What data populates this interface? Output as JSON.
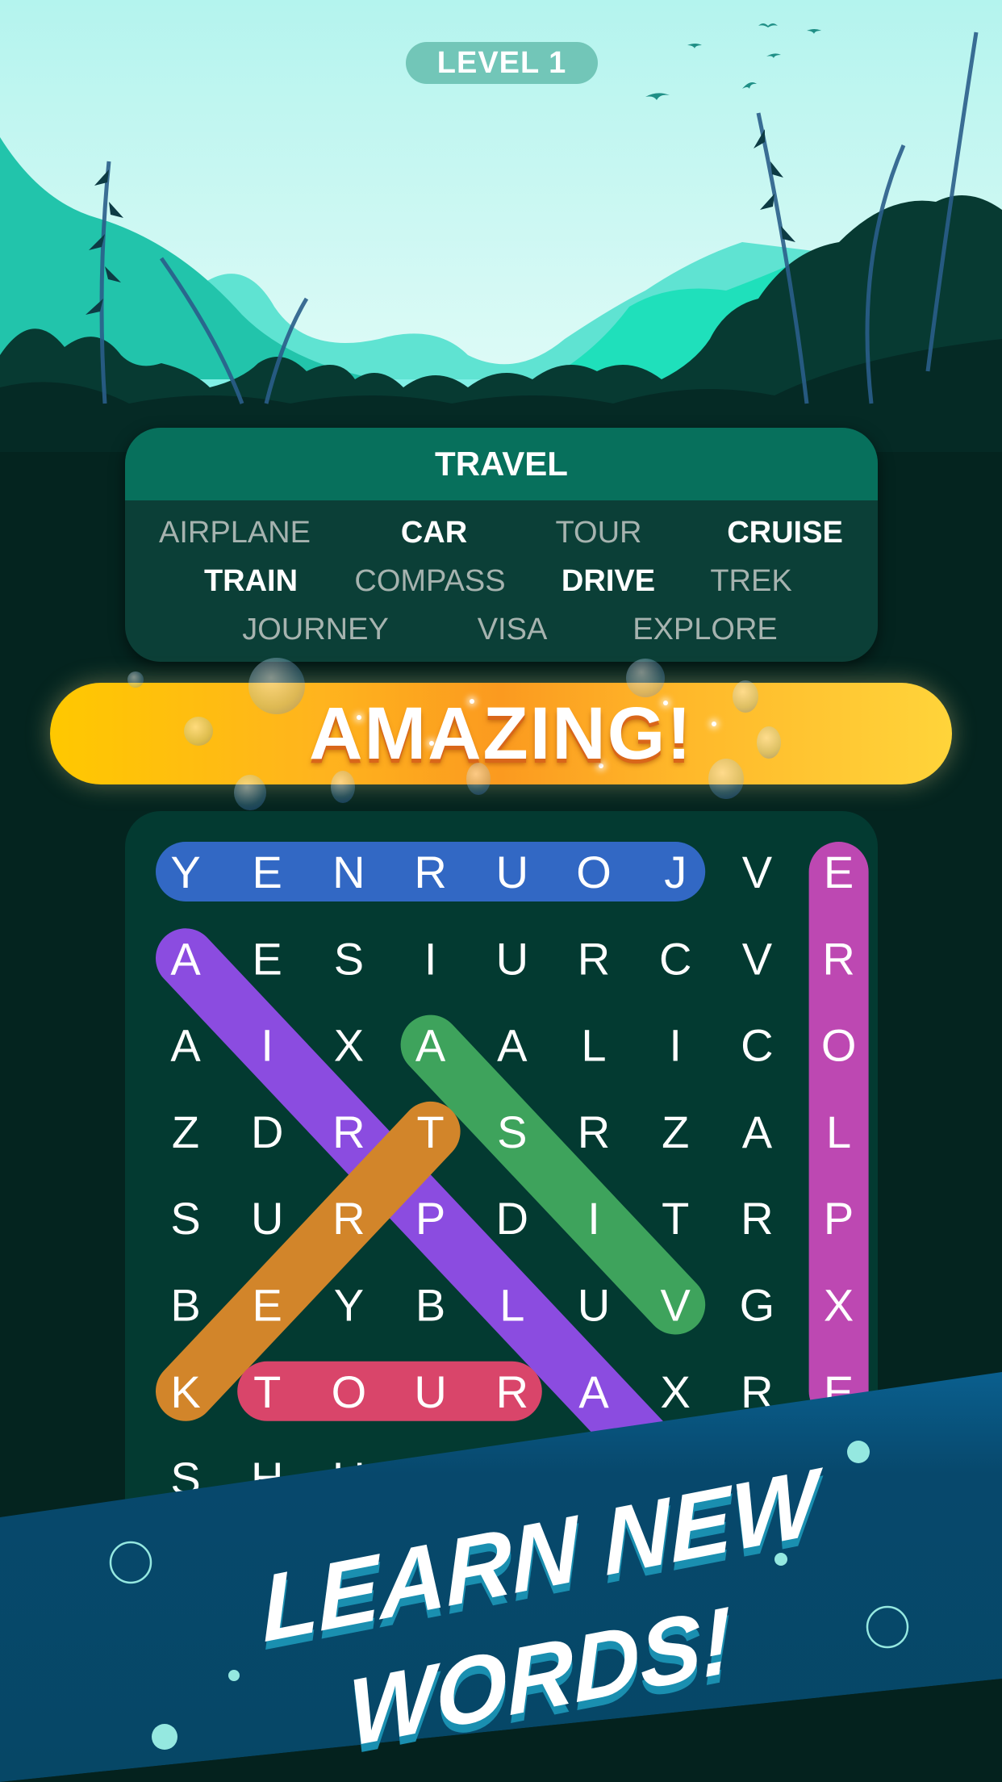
{
  "header": {
    "level_label": "LEVEL 1"
  },
  "word_list": {
    "category": "TRAVEL",
    "rows": [
      [
        {
          "text": "AIRPLANE",
          "found": true
        },
        {
          "text": "CAR",
          "found": false
        },
        {
          "text": "TOUR",
          "found": true
        },
        {
          "text": "CRUISE",
          "found": false
        }
      ],
      [
        {
          "text": "TRAIN",
          "found": false
        },
        {
          "text": "COMPASS",
          "found": true
        },
        {
          "text": "DRIVE",
          "found": false
        },
        {
          "text": "TREK",
          "found": true
        }
      ],
      [
        {
          "text": "JOURNEY",
          "found": true
        },
        {
          "text": "VISA",
          "found": true
        },
        {
          "text": "EXPLORE",
          "found": true
        }
      ]
    ]
  },
  "celebration": {
    "text": "AMAZING!"
  },
  "grid": {
    "columns": 9,
    "rows": [
      [
        "Y",
        "E",
        "N",
        "R",
        "U",
        "O",
        "J",
        "V",
        "E"
      ],
      [
        "A",
        "E",
        "S",
        "I",
        "U",
        "R",
        "C",
        "V",
        "R"
      ],
      [
        "A",
        "I",
        "X",
        "A",
        "A",
        "L",
        "I",
        "C",
        "O"
      ],
      [
        "Z",
        "D",
        "R",
        "T",
        "S",
        "R",
        "Z",
        "A",
        "L"
      ],
      [
        "S",
        "U",
        "R",
        "P",
        "D",
        "I",
        "T",
        "R",
        "P"
      ],
      [
        "B",
        "E",
        "Y",
        "B",
        "L",
        "U",
        "V",
        "G",
        "X"
      ],
      [
        "K",
        "T",
        "O",
        "U",
        "R",
        "A",
        "X",
        "R",
        "E"
      ],
      [
        "S",
        "H",
        "U",
        "",
        "",
        "",
        "",
        "",
        ""
      ]
    ],
    "highlights": [
      {
        "word": "JOURNEY",
        "color": "#3268c4",
        "from": [
          0,
          6
        ],
        "to": [
          0,
          0
        ]
      },
      {
        "word": "EXPLORE",
        "color": "#bd48b2",
        "from": [
          6,
          8
        ],
        "to": [
          0,
          8
        ]
      },
      {
        "word": "AIRPLANE",
        "color": "#8b4ce0",
        "from": [
          1,
          0
        ],
        "to": [
          7,
          6
        ]
      },
      {
        "word": "VISA",
        "color": "#3ea35c",
        "from": [
          5,
          6
        ],
        "to": [
          2,
          3
        ]
      },
      {
        "word": "TREK",
        "color": "#d2852a",
        "from": [
          3,
          3
        ],
        "to": [
          6,
          0
        ]
      },
      {
        "word": "TOUR",
        "color": "#d9456a",
        "from": [
          6,
          1
        ],
        "to": [
          6,
          4
        ]
      }
    ]
  },
  "promo": {
    "line1": "LEARN NEW",
    "line2": "WORDS!"
  },
  "colors": {
    "banner": "#07476a",
    "accent_dot": "#95e8e0"
  }
}
